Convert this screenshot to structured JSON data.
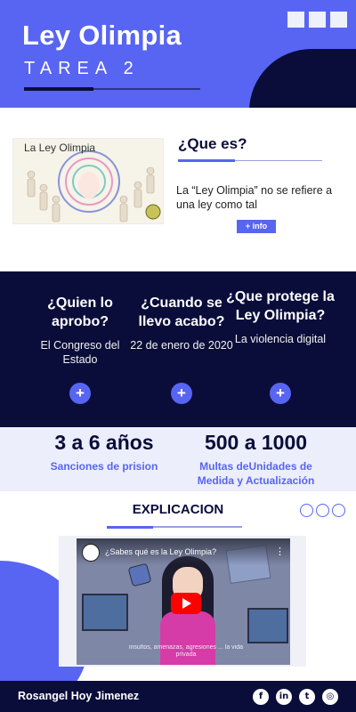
{
  "header": {
    "title": "Ley Olimpia",
    "subtitle": "TAREA 2"
  },
  "whatis": {
    "illustration_text": "La Ley Olimpia",
    "heading": "¿Que es?",
    "description": "La “Ley Olimpia” no se refiere a una ley como tal",
    "info_button": "+ info"
  },
  "questions": [
    {
      "title": "¿Quien lo aprobo?",
      "answer": "El Congreso del Estado",
      "button": "+"
    },
    {
      "title": "¿Cuando se llevo acabo?",
      "answer": "22 de enero de 2020",
      "button": "+"
    },
    {
      "title": "¿Que protege la Ley Olimpia?",
      "answer": "La violencia digital",
      "button": "+"
    }
  ],
  "stats": [
    {
      "value": "3 a 6 años",
      "label": "Sanciones de prision"
    },
    {
      "value": "500 a 1000",
      "label": "Multas deUnidades de Medida y Actualización"
    }
  ],
  "explicacion": {
    "heading": "EXPLICACION",
    "video_title": "¿Sabes qué es la Ley Olimpia?",
    "video_subtitle": "insultos, amenazas, agresiones ... la vida privada"
  },
  "footer": {
    "name": "Rosangel Hoy Jimenez",
    "socials": [
      "facebook-icon",
      "linkedin-icon",
      "twitter-icon",
      "instagram-icon"
    ]
  },
  "colors": {
    "accent": "#5865f2",
    "dark": "#0a0d3a",
    "light": "#eceefb"
  }
}
